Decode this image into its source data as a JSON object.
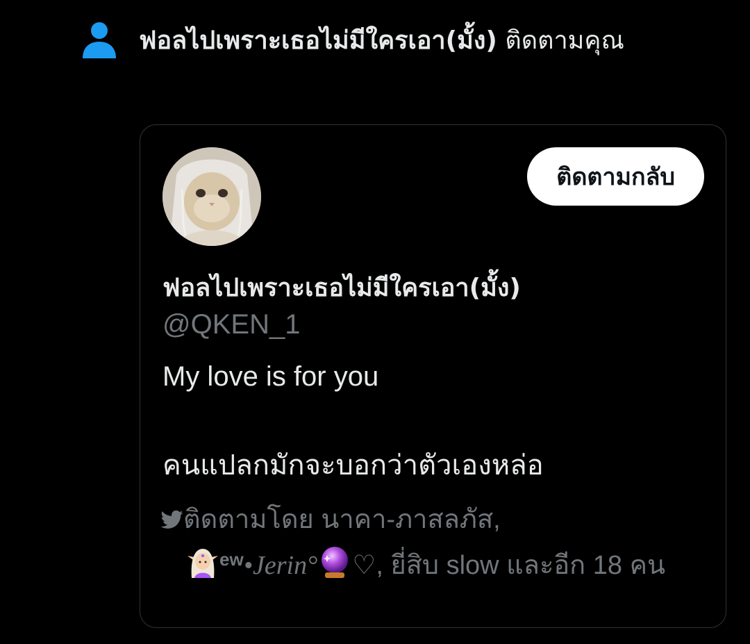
{
  "notification": {
    "icon": "person-icon",
    "icon_color": "#1d9bf0",
    "actor_name": "ฟอลไปเพราะเธอไม่มีใครเอา(มั้ง)",
    "action_text": "ติดตามคุณ"
  },
  "card": {
    "avatar": "cat-avatar-icon",
    "follow_back_label": "ติดตามกลับ",
    "display_name": "ฟอลไปเพราะเธอไม่มีใครเอา(มั้ง)",
    "handle": "@QKEN_1",
    "bio_lines": [
      "My love is for you",
      "",
      "คนแปลกมักจะบอกว่าตัวเองหล่อ"
    ],
    "followed_by": {
      "icon": "twitter-bird-icon",
      "prefix": "ติดตามโดย",
      "follower_1": "นาคา-ภาสลภัส,",
      "follower_2_emoji": "elf-emoji",
      "follower_2_sup": "ew",
      "follower_2_name": "•Jerin°",
      "follower_2_trailing_emoji": "crystal-ball-emoji",
      "follower_2_heart": "♡,",
      "follower_3": "ยี่สิบ slow",
      "suffix": "และอีก 18 คน"
    }
  },
  "colors": {
    "background": "#000000",
    "text_primary": "#e7e9ea",
    "text_secondary": "#71767b",
    "border": "#2f3336",
    "accent": "#1d9bf0",
    "button_bg": "#ffffff",
    "button_text": "#0f1419"
  }
}
